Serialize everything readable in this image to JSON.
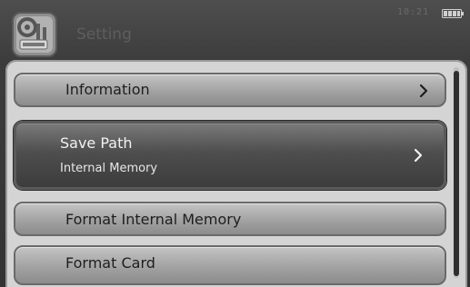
{
  "header": {
    "title": "Setting",
    "clock": "10:21",
    "app_icon": "settings-gear-icon",
    "battery_icon": "battery-icon"
  },
  "menu": {
    "items": [
      {
        "label": "Information",
        "icon": "chevron-right-icon"
      },
      {
        "label": "Save Path",
        "value": "Internal Memory",
        "icon": "chevron-right-icon",
        "selected": true
      },
      {
        "label": "Format Internal Memory"
      },
      {
        "label": "Format Card"
      }
    ]
  },
  "colors": {
    "background": "#3c3c3c",
    "panel": "#d4d4d4",
    "item": "#a2a2a2",
    "selected_item": "#4e4e4e"
  }
}
